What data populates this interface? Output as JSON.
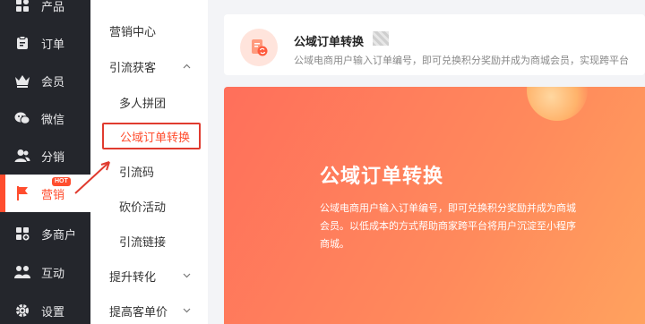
{
  "nav": {
    "items": [
      {
        "label": "产品",
        "icon": "grid-icon"
      },
      {
        "label": "订单",
        "icon": "clipboard-icon"
      },
      {
        "label": "会员",
        "icon": "crown-icon"
      },
      {
        "label": "微信",
        "icon": "wechat-icon"
      },
      {
        "label": "分销",
        "icon": "users-icon"
      },
      {
        "label": "营销",
        "icon": "flag-icon",
        "badge": "HOT"
      },
      {
        "label": "多商户",
        "icon": "store-plus-icon"
      },
      {
        "label": "互动",
        "icon": "people-icon"
      },
      {
        "label": "设置",
        "icon": "gear-icon"
      }
    ]
  },
  "subnav": {
    "items": [
      {
        "label": "营销中心",
        "type": "group"
      },
      {
        "label": "引流获客",
        "type": "group",
        "chevron": "⌃"
      },
      {
        "label": "多人拼团",
        "type": "child"
      },
      {
        "label": "公域订单转换",
        "type": "child"
      },
      {
        "label": "引流码",
        "type": "child"
      },
      {
        "label": "砍价活动",
        "type": "child"
      },
      {
        "label": "引流链接",
        "type": "child"
      },
      {
        "label": "提升转化",
        "type": "group",
        "chevron": "⌄"
      },
      {
        "label": "提高客单价",
        "type": "group",
        "chevron": "⌄"
      }
    ]
  },
  "card": {
    "title": "公域订单转换",
    "desc": "公域电商用户输入订单编号，即可兑换积分奖励并成为商城会员，实现跨平台"
  },
  "banner": {
    "title": "公域订单转换",
    "desc": "公域电商用户输入订单编号，即可兑换积分奖励并成为商城会员。以低成本的方式帮助商家跨平台将用户沉淀至小程序商城。"
  },
  "colors": {
    "accent": "#ff4d2e",
    "nav_bg": "#24262c",
    "annotation": "#e03b2f"
  }
}
